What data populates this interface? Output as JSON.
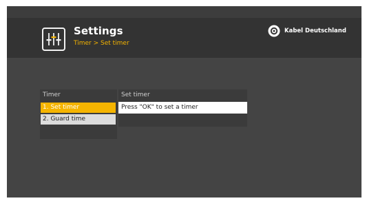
{
  "header": {
    "title": "Settings",
    "breadcrumb": "Timer > Set timer",
    "brand": "Kabel Deutschland"
  },
  "left_panel": {
    "header": "Timer",
    "items": [
      {
        "label": "1. Set timer",
        "selected": true
      },
      {
        "label": "2. Guard time",
        "selected": false
      }
    ]
  },
  "right_panel": {
    "header": "Set timer",
    "info": "Press \"OK\" to set a timer"
  },
  "colors": {
    "accent": "#f5b400",
    "background": "#444444",
    "header_bg": "#333333"
  },
  "icons": {
    "settings": "equalizer-sliders-icon",
    "brand": "kabel-deutschland-logo"
  }
}
